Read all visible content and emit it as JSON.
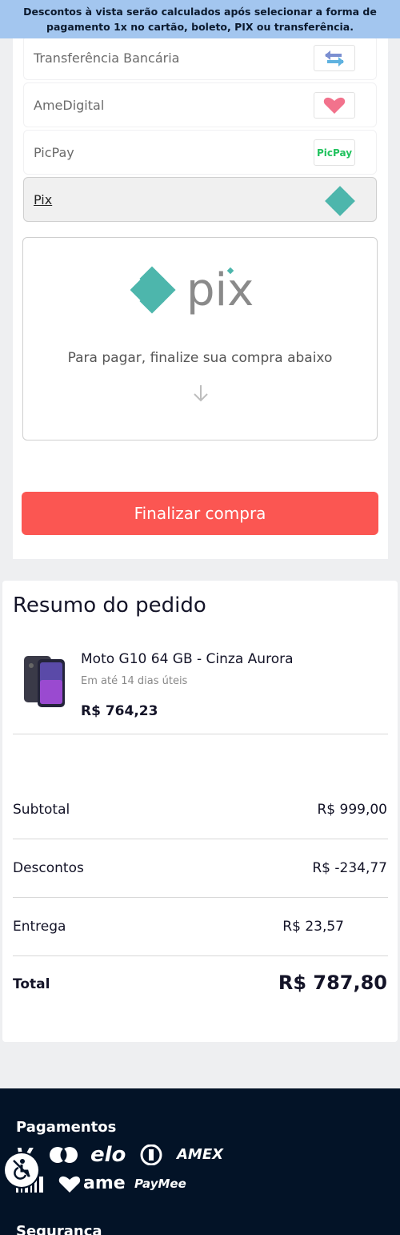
{
  "banner": {
    "text": "Descontos à vista serão calculados após selecionar a forma de pagamento 1x no cartão, boleto, PIX ou transferência."
  },
  "payment_methods": [
    {
      "label": "Transferência Bancária",
      "icon": "transfer-arrows-icon",
      "selected": false
    },
    {
      "label": "AmeDigital",
      "icon": "ame-heart-icon",
      "selected": false
    },
    {
      "label": "PicPay",
      "icon": "picpay-logo",
      "logo_text": "PicPay",
      "selected": false
    },
    {
      "label": "Pix",
      "icon": "pix-logo-icon",
      "selected": true
    }
  ],
  "pix_panel": {
    "logo_text": "pix",
    "instruction": "Para pagar, finalize sua compra abaixo",
    "icon": "arrow-down-icon"
  },
  "finalize_button": "Finalizar compra",
  "summary": {
    "title": "Resumo do pedido",
    "product": {
      "name": "Moto G10 64 GB - Cinza Aurora",
      "delivery": "Em até 14 dias úteis",
      "price": "R$ 764,23"
    },
    "rows": [
      {
        "label": "Subtotal",
        "value": "R$ 999,00"
      },
      {
        "label": "Descontos",
        "value": "R$ -234,77"
      },
      {
        "label": "Entrega",
        "value": "R$ 23,57"
      }
    ],
    "total": {
      "label": "Total",
      "value": "R$ 787,80"
    }
  },
  "footer": {
    "payments_title": "Pagamentos",
    "security_title": "Segurança",
    "payment_brands": [
      "visa",
      "mastercard",
      "elo",
      "diners",
      "AMEX",
      "boleto",
      "ame",
      "PayMee"
    ],
    "ame_text": "ame",
    "paymee_text": "PayMee",
    "amex_text": "AMEX",
    "elo_text": "elo"
  },
  "colors": {
    "banner_bg": "#a3c6ef",
    "accent_red": "#fb5652",
    "pix_teal": "#4db6ac",
    "footer_bg": "#031327"
  }
}
